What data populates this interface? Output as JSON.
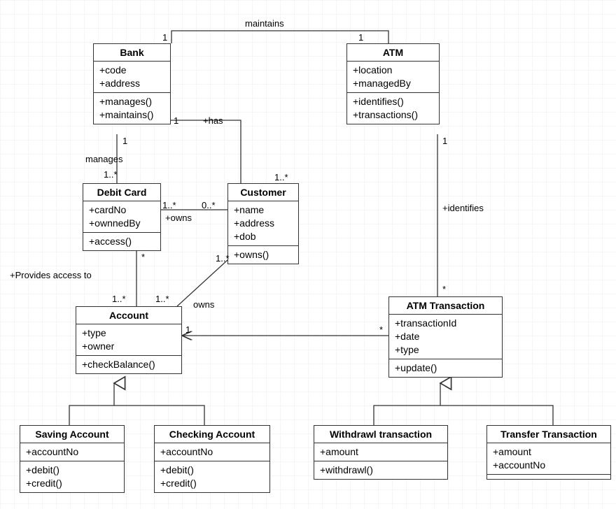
{
  "classes": {
    "bank": {
      "name": "Bank",
      "attrs": [
        "+code",
        "+address"
      ],
      "ops": [
        "+manages()",
        "+maintains()"
      ]
    },
    "atm": {
      "name": "ATM",
      "attrs": [
        "+location",
        "+managedBy"
      ],
      "ops": [
        "+identifies()",
        "+transactions()"
      ]
    },
    "debitcard": {
      "name": "Debit Card",
      "attrs": [
        "+cardNo",
        "+ownnedBy"
      ],
      "ops": [
        "+access()"
      ]
    },
    "customer": {
      "name": "Customer",
      "attrs": [
        "+name",
        "+address",
        "+dob"
      ],
      "ops": [
        "+owns()"
      ]
    },
    "account": {
      "name": "Account",
      "attrs": [
        "+type",
        "+owner"
      ],
      "ops": [
        "+checkBalance()"
      ]
    },
    "atmtxn": {
      "name": "ATM Transaction",
      "attrs": [
        "+transactionId",
        "+date",
        "+type"
      ],
      "ops": [
        "+update()"
      ]
    },
    "saving": {
      "name": "Saving Account",
      "attrs": [
        "+accountNo"
      ],
      "ops": [
        "+debit()",
        "+credit()"
      ]
    },
    "checking": {
      "name": "Checking Account",
      "attrs": [
        "+accountNo"
      ],
      "ops": [
        "+debit()",
        "+credit()"
      ]
    },
    "withdrawl": {
      "name": "Withdrawl transaction",
      "attrs": [
        "+amount"
      ],
      "ops": [
        "+withdrawl()"
      ]
    },
    "transfer": {
      "name": "Transfer Transaction",
      "attrs": [
        "+amount",
        "+accountNo"
      ],
      "ops": []
    }
  },
  "labels": {
    "maintains": "maintains",
    "one_bank_top": "1",
    "one_atm_top": "1",
    "one_bank_right": "1",
    "has": "+has",
    "one_bank_bottom": "1",
    "manages": "manages",
    "one_star_debit": "1..*",
    "one_star_customer": "1..*",
    "one_star_debit_right": "1..*",
    "zero_star_customer_left": "0..*",
    "owns_debit": "+owns",
    "one_atm_bottom": "1",
    "identifies": "+identifies",
    "star_atmtxn": "*",
    "star_debit_bottom": "*",
    "provides": "+Provides access to",
    "one_star_account_top": "1..*",
    "one_star_customer_bottom": "1..*",
    "one_star_account_right": "1..*",
    "owns_account": "owns",
    "one_account_right": "1",
    "star_txn_left": "*"
  },
  "chart_data": {
    "type": "uml-class-diagram",
    "classes": [
      {
        "id": "Bank",
        "attributes": [
          "+code",
          "+address"
        ],
        "operations": [
          "+manages()",
          "+maintains()"
        ]
      },
      {
        "id": "ATM",
        "attributes": [
          "+location",
          "+managedBy"
        ],
        "operations": [
          "+identifies()",
          "+transactions()"
        ]
      },
      {
        "id": "Debit Card",
        "attributes": [
          "+cardNo",
          "+ownnedBy"
        ],
        "operations": [
          "+access()"
        ]
      },
      {
        "id": "Customer",
        "attributes": [
          "+name",
          "+address",
          "+dob"
        ],
        "operations": [
          "+owns()"
        ]
      },
      {
        "id": "Account",
        "attributes": [
          "+type",
          "+owner"
        ],
        "operations": [
          "+checkBalance()"
        ]
      },
      {
        "id": "ATM Transaction",
        "attributes": [
          "+transactionId",
          "+date",
          "+type"
        ],
        "operations": [
          "+update()"
        ]
      },
      {
        "id": "Saving Account",
        "attributes": [
          "+accountNo"
        ],
        "operations": [
          "+debit()",
          "+credit()"
        ]
      },
      {
        "id": "Checking Account",
        "attributes": [
          "+accountNo"
        ],
        "operations": [
          "+debit()",
          "+credit()"
        ]
      },
      {
        "id": "Withdrawl transaction",
        "attributes": [
          "+amount"
        ],
        "operations": [
          "+withdrawl()"
        ]
      },
      {
        "id": "Transfer Transaction",
        "attributes": [
          "+amount",
          "+accountNo"
        ],
        "operations": []
      }
    ],
    "relationships": [
      {
        "type": "association",
        "from": "Bank",
        "to": "ATM",
        "label": "maintains",
        "fromMult": "1",
        "toMult": "1"
      },
      {
        "type": "association",
        "from": "Bank",
        "to": "Customer",
        "label": "+has",
        "fromMult": "1",
        "toMult": "1..*"
      },
      {
        "type": "association",
        "from": "Bank",
        "to": "Debit Card",
        "label": "manages",
        "fromMult": "1",
        "toMult": "1..*"
      },
      {
        "type": "association",
        "from": "Debit Card",
        "to": "Customer",
        "label": "+owns",
        "fromMult": "1..*",
        "toMult": "0..*"
      },
      {
        "type": "association",
        "from": "Debit Card",
        "to": "Account",
        "label": "+Provides access to",
        "fromMult": "*",
        "toMult": "1..*"
      },
      {
        "type": "association",
        "from": "Customer",
        "to": "Account",
        "label": "owns",
        "fromMult": "1..*",
        "toMult": "1..*"
      },
      {
        "type": "association",
        "from": "ATM",
        "to": "ATM Transaction",
        "label": "+identifies",
        "fromMult": "1",
        "toMult": "*"
      },
      {
        "type": "association-directed",
        "from": "ATM Transaction",
        "to": "Account",
        "fromMult": "*",
        "toMult": "1"
      },
      {
        "type": "generalization",
        "parent": "Account",
        "children": [
          "Saving Account",
          "Checking Account"
        ]
      },
      {
        "type": "generalization",
        "parent": "ATM Transaction",
        "children": [
          "Withdrawl transaction",
          "Transfer Transaction"
        ]
      }
    ]
  }
}
